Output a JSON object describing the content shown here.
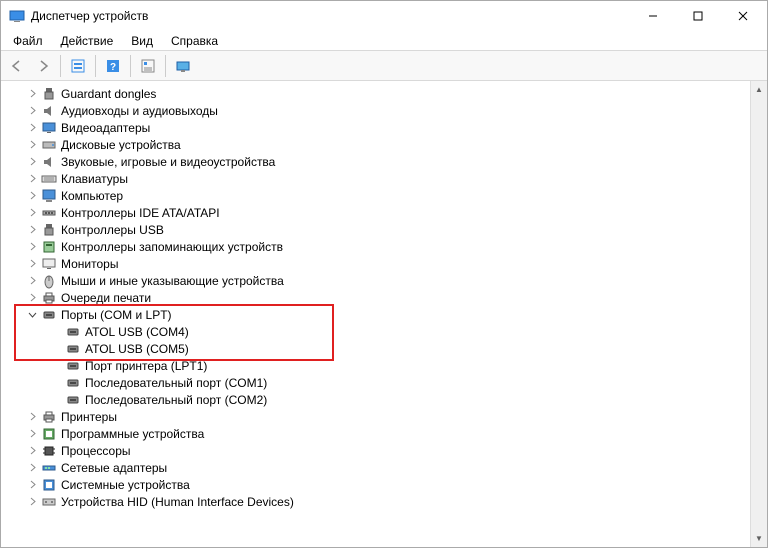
{
  "title": "Диспетчер устройств",
  "menu": {
    "file": "Файл",
    "action": "Действие",
    "view": "Вид",
    "help": "Справка"
  },
  "tree": [
    {
      "label": "Guardant dongles",
      "icon": "usb",
      "expanded": false,
      "depth": 1
    },
    {
      "label": "Аудиовходы и аудиовыходы",
      "icon": "audio",
      "expanded": false,
      "depth": 1
    },
    {
      "label": "Видеоадаптеры",
      "icon": "display",
      "expanded": false,
      "depth": 1
    },
    {
      "label": "Дисковые устройства",
      "icon": "disk",
      "expanded": false,
      "depth": 1
    },
    {
      "label": "Звуковые, игровые и видеоустройства",
      "icon": "audio",
      "expanded": false,
      "depth": 1
    },
    {
      "label": "Клавиатуры",
      "icon": "keyboard",
      "expanded": false,
      "depth": 1
    },
    {
      "label": "Компьютер",
      "icon": "computer",
      "expanded": false,
      "depth": 1
    },
    {
      "label": "Контроллеры IDE ATA/ATAPI",
      "icon": "ide",
      "expanded": false,
      "depth": 1
    },
    {
      "label": "Контроллеры USB",
      "icon": "usb",
      "expanded": false,
      "depth": 1
    },
    {
      "label": "Контроллеры запоминающих устройств",
      "icon": "storage",
      "expanded": false,
      "depth": 1
    },
    {
      "label": "Мониторы",
      "icon": "monitor",
      "expanded": false,
      "depth": 1
    },
    {
      "label": "Мыши и иные указывающие устройства",
      "icon": "mouse",
      "expanded": false,
      "depth": 1
    },
    {
      "label": "Очереди печати",
      "icon": "printer",
      "expanded": false,
      "depth": 1
    },
    {
      "label": "Порты (COM и LPT)",
      "icon": "port",
      "expanded": true,
      "depth": 1,
      "highlighted": true
    },
    {
      "label": "ATOL USB (COM4)",
      "icon": "port",
      "expanded": null,
      "depth": 2,
      "highlighted": true
    },
    {
      "label": "ATOL USB (COM5)",
      "icon": "port",
      "expanded": null,
      "depth": 2,
      "highlighted": true
    },
    {
      "label": "Порт принтера (LPT1)",
      "icon": "port",
      "expanded": null,
      "depth": 2
    },
    {
      "label": "Последовательный порт (COM1)",
      "icon": "port",
      "expanded": null,
      "depth": 2
    },
    {
      "label": "Последовательный порт (COM2)",
      "icon": "port",
      "expanded": null,
      "depth": 2
    },
    {
      "label": "Принтеры",
      "icon": "printer",
      "expanded": false,
      "depth": 1
    },
    {
      "label": "Программные устройства",
      "icon": "software",
      "expanded": false,
      "depth": 1
    },
    {
      "label": "Процессоры",
      "icon": "cpu",
      "expanded": false,
      "depth": 1
    },
    {
      "label": "Сетевые адаптеры",
      "icon": "network",
      "expanded": false,
      "depth": 1
    },
    {
      "label": "Системные устройства",
      "icon": "system",
      "expanded": false,
      "depth": 1
    },
    {
      "label": "Устройства HID (Human Interface Devices)",
      "icon": "hid",
      "expanded": false,
      "depth": 1
    }
  ]
}
